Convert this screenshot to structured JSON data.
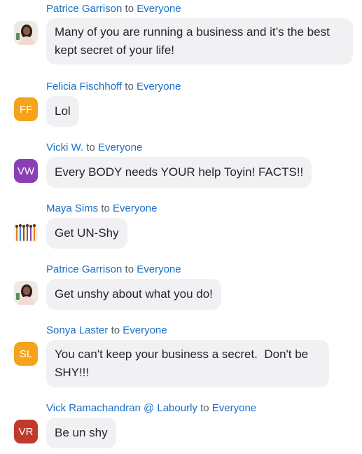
{
  "chat": {
    "messages": [
      {
        "sender": "Patrice Garrison",
        "to_word": "to",
        "recipient": "Everyone",
        "text": "Many of you are running a business and it’s the best kept secret of your life!",
        "avatar": {
          "type": "photo",
          "icon": "profile-photo-icon"
        }
      },
      {
        "sender": "Felicia Fischhoff",
        "to_word": "to",
        "recipient": "Everyone",
        "text": "Lol",
        "avatar": {
          "type": "initials",
          "initials": "FF",
          "color": "#f5a31a"
        }
      },
      {
        "sender": "Vicki W.",
        "to_word": "to",
        "recipient": "Everyone",
        "text": "Every BODY needs YOUR help Toyin! FACTS!!",
        "avatar": {
          "type": "initials",
          "initials": "VW",
          "color": "#8a3fb5"
        }
      },
      {
        "sender": "Maya Sims",
        "to_word": "to",
        "recipient": "Everyone",
        "text": "Get UN-Shy",
        "avatar": {
          "type": "photo",
          "icon": "group-illustration-icon"
        }
      },
      {
        "sender": "Patrice Garrison",
        "to_word": "to",
        "recipient": "Everyone",
        "text": "Get unshy about what you do!",
        "avatar": {
          "type": "photo",
          "icon": "profile-photo-icon"
        }
      },
      {
        "sender": "Sonya Laster",
        "to_word": "to",
        "recipient": "Everyone",
        "text": "You can't keep your business a secret.  Don't be SHY!!!",
        "avatar": {
          "type": "initials",
          "initials": "SL",
          "color": "#f5a31a"
        }
      },
      {
        "sender": "Vick Ramachandran @ Labourly",
        "to_word": "to",
        "recipient": "Everyone",
        "text": "Be un shy",
        "avatar": {
          "type": "initials",
          "initials": "VR",
          "color": "#c0392b"
        }
      }
    ]
  }
}
